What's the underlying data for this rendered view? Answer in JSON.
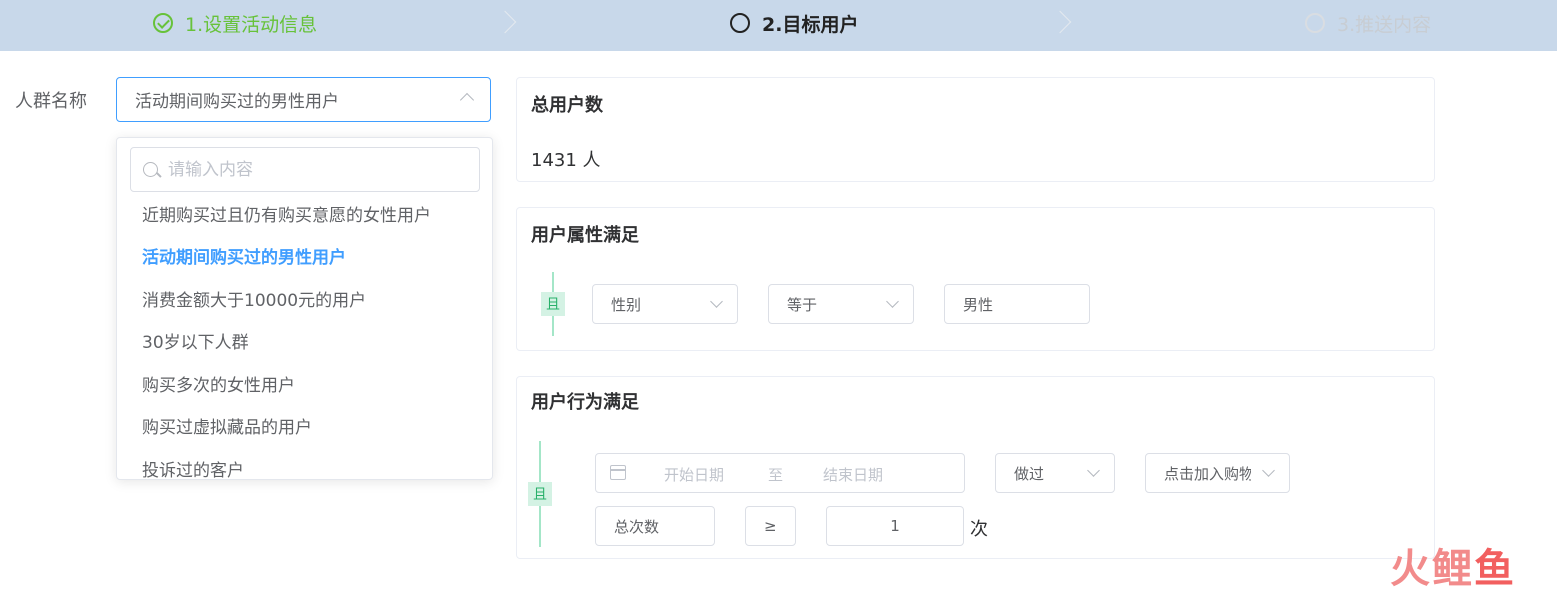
{
  "steps": [
    {
      "label": "1.设置活动信息",
      "status": "done"
    },
    {
      "label": "2.目标用户",
      "status": "active"
    },
    {
      "label": "3.推送内容",
      "status": "wait"
    }
  ],
  "form": {
    "crowd_label": "人群名称",
    "crowd_value": "活动期间购买过的男性用户",
    "search_placeholder": "请输入内容",
    "options": [
      "近期购买过且仍有购买意愿的女性用户",
      "活动期间购买过的男性用户",
      "消费金额大于10000元的用户",
      "30岁以下人群",
      "购买多次的女性用户",
      "购买过虚拟藏品的用户",
      "投诉过的客户"
    ],
    "selected_index": 1
  },
  "total_card": {
    "title": "总用户数",
    "value": "1431 人"
  },
  "attr_card": {
    "title": "用户属性满足",
    "and_label": "且",
    "field": "性别",
    "operator": "等于",
    "value": "男性"
  },
  "behavior_card": {
    "title": "用户行为满足",
    "and_label": "且",
    "start_placeholder": "开始日期",
    "to_label": "至",
    "end_placeholder": "结束日期",
    "action": "做过",
    "event": "点击加入购物",
    "metric": "总次数",
    "compare": "≥",
    "count": "1",
    "unit": "次"
  },
  "watermark": {
    "text": "火鲤鱼"
  },
  "colors": {
    "header_bg": "#c8d8ea",
    "done": "#67c23a",
    "accent": "#409eff",
    "and_tag": "#28b06a"
  }
}
